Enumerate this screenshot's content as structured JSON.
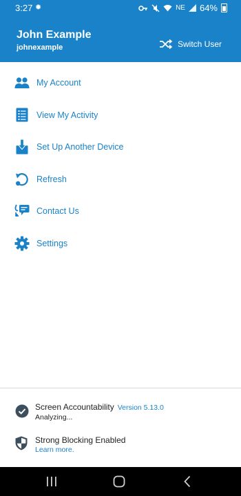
{
  "status_bar": {
    "time": "3:27",
    "network_label": "NE",
    "battery_percent": "64%"
  },
  "header": {
    "display_name": "John Example",
    "username": "johnexample",
    "switch_user_label": "Switch User"
  },
  "menu": {
    "items": [
      {
        "label": "My Account",
        "icon": "users-icon"
      },
      {
        "label": "View My Activity",
        "icon": "activity-list-icon"
      },
      {
        "label": "Set Up Another Device",
        "icon": "download-device-icon"
      },
      {
        "label": "Refresh",
        "icon": "refresh-icon"
      },
      {
        "label": "Contact Us",
        "icon": "contact-chat-icon"
      },
      {
        "label": "Settings",
        "icon": "gear-icon"
      }
    ]
  },
  "footer": {
    "accountability_title": "Screen Accountability",
    "version": "Version 5.13.0",
    "accountability_status": "Analyzing...",
    "blocking_title": "Strong Blocking Enabled",
    "learn_more": "Learn more."
  },
  "colors": {
    "accent": "#1a82c8",
    "icon_dark": "#3d4f5c"
  }
}
